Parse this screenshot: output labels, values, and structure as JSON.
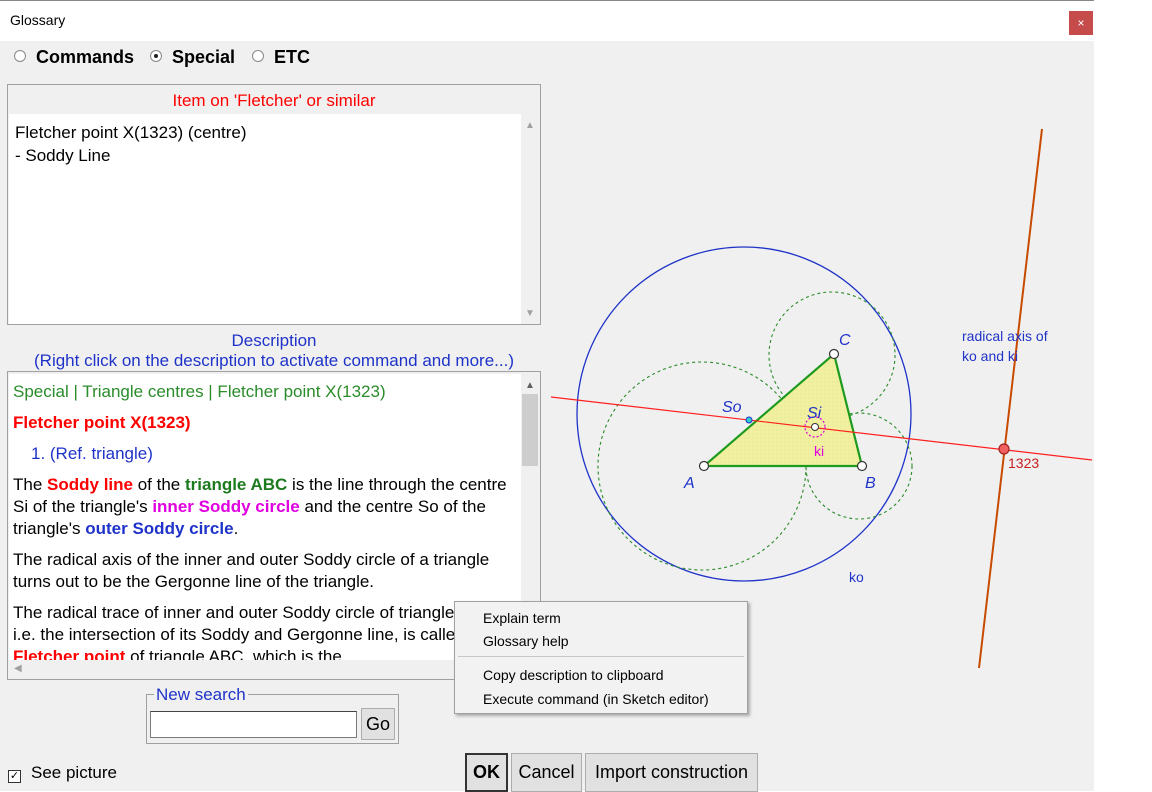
{
  "window": {
    "title": "Glossary",
    "close_glyph": "×"
  },
  "mode_radios": [
    {
      "label": "Commands",
      "selected": false
    },
    {
      "label": "Special",
      "selected": true
    },
    {
      "label": "ETC",
      "selected": false
    }
  ],
  "item_panel": {
    "title": "Item on 'Fletcher' or similar",
    "items": [
      "Fletcher point X(1323) (centre)",
      "- Soddy Line"
    ]
  },
  "description": {
    "label_line1": "Description",
    "label_line2": "(Right click on the description to activate command and more...)",
    "breadcrumb": "Special | Triangle centres | Fletcher point X(1323)",
    "heading": "Fletcher point X(1323)",
    "ref": "1.  (Ref. triangle)",
    "p1": {
      "t1": "The ",
      "k1": "Soddy line",
      "t2": " of the ",
      "k2": "triangle ABC",
      "t3": " is the line through the centre Si of the triangle's ",
      "k3": "inner Soddy circle",
      "t4": " and the centre So of the triangle's ",
      "k4": "outer Soddy circle",
      "t5": "."
    },
    "p2": "The radical axis of the inner and outer Soddy circle of a triangle turns out to be the Gergonne line of the triangle.",
    "p3": {
      "t1": "The radical trace of inner and outer Soddy circle of triangle ABC, i.e. the intersection of its Soddy and Gergonne line, is called the ",
      "k1": "Fletcher point",
      "t2": " of triangle ABC, which is the"
    }
  },
  "new_search": {
    "legend": "New search",
    "value": "",
    "go_label": "Go"
  },
  "see_picture": {
    "label": "See picture",
    "checked": true,
    "check_glyph": "✓"
  },
  "buttons": {
    "ok": "OK",
    "cancel": "Cancel",
    "import": "Import construction"
  },
  "figure": {
    "label_a": "A",
    "label_b": "B",
    "label_c": "C",
    "label_so": "So",
    "label_si": "Si",
    "label_ki": "ki",
    "label_ko": "ko",
    "label_point": "1323",
    "label_axis_line1": "radical axis of",
    "label_axis_line2": "ko and ki",
    "colors": {
      "circle_outer": "#1f33c9",
      "circles_dashed": "#2a8c2a",
      "triangle": "#1e9b1e",
      "triangle_fill": "#f0f0a0",
      "soddy_line": "#ff2020",
      "axis_line": "#c84a00",
      "ki_circle": "#e000e0"
    }
  },
  "context_menu": {
    "items": [
      "Explain term",
      "Glossary help",
      "Copy description to clipboard",
      "Execute command (in Sketch editor)"
    ]
  }
}
